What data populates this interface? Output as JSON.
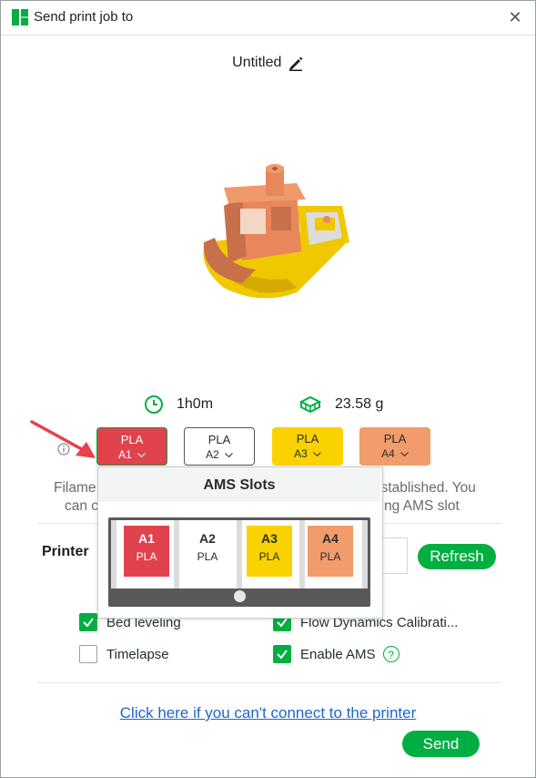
{
  "window": {
    "title": "Send print job to"
  },
  "job": {
    "name": "Untitled"
  },
  "stats": {
    "time": "1h0m",
    "weight": "23.58 g"
  },
  "filaments": [
    {
      "type": "PLA",
      "slot": "A1",
      "color": "#e0434c",
      "text_color": "#ffffff"
    },
    {
      "type": "PLA",
      "slot": "A2",
      "color": "#ffffff",
      "text_color": "#262e30"
    },
    {
      "type": "PLA",
      "slot": "A3",
      "color": "#f9d200",
      "text_color": "#262e30"
    },
    {
      "type": "PLA",
      "slot": "A4",
      "color": "#f39c6b",
      "text_color": "#262e30"
    }
  ],
  "background_text": {
    "line1_left": "Filame",
    "line1_right": "established. You",
    "line2_left": "can c",
    "line2_right": "ping AMS slot"
  },
  "printer": {
    "label": "Printer",
    "refresh_label": "Refresh"
  },
  "options": {
    "bed_leveling": {
      "label": "Bed leveling",
      "checked": true
    },
    "flow_calibration": {
      "label": "Flow Dynamics Calibrati...",
      "checked": true
    },
    "timelapse": {
      "label": "Timelapse",
      "checked": false
    },
    "enable_ams": {
      "label": "Enable AMS",
      "checked": true
    }
  },
  "help_icon": "?",
  "help_link": "Click here if you can't connect to the printer",
  "send_label": "Send",
  "ams_popup": {
    "title": "AMS Slots",
    "slots": [
      {
        "id": "A1",
        "material": "PLA",
        "color": "#e0434c"
      },
      {
        "id": "A2",
        "material": "PLA",
        "color": "#ffffff"
      },
      {
        "id": "A3",
        "material": "PLA",
        "color": "#f9d200"
      },
      {
        "id": "A4",
        "material": "PLA",
        "color": "#f39c6b"
      }
    ]
  },
  "icons": {
    "app": "bambu-logo-icon",
    "close": "close-icon",
    "edit": "pencil-icon",
    "time": "clock-icon",
    "weight": "filament-spool-icon",
    "annotation": "red-arrow-icon"
  },
  "colors": {
    "accent": "#00ae42",
    "link": "#1f66c4",
    "arrow": "#e8404a"
  }
}
